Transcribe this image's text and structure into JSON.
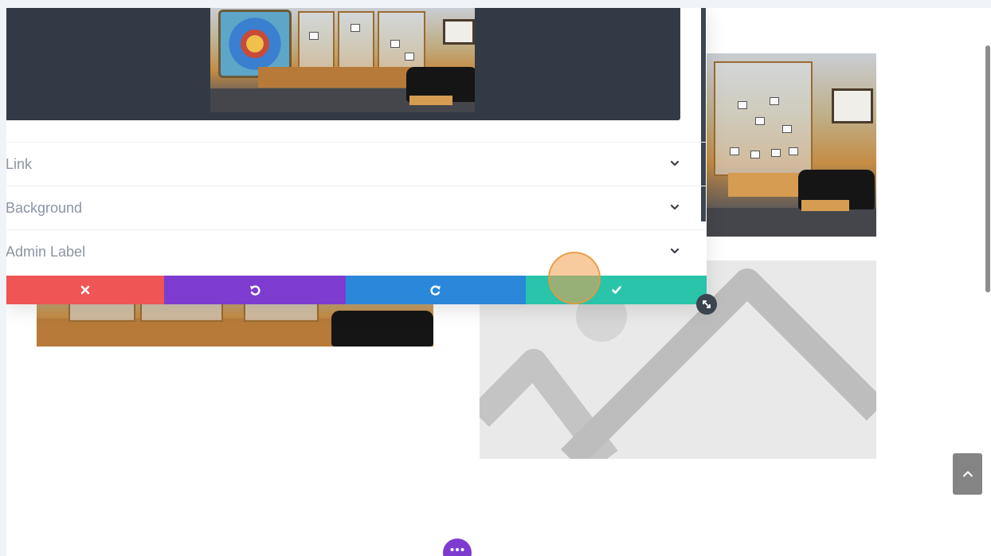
{
  "accordion": {
    "items": [
      {
        "label": "Link",
        "icon": "chevron-down-icon"
      },
      {
        "label": "Background",
        "icon": "chevron-down-icon"
      },
      {
        "label": "Admin Label",
        "icon": "chevron-down-icon"
      }
    ]
  },
  "action_bar": {
    "discard": {
      "icon": "close-icon",
      "color": "#ef5555"
    },
    "undo": {
      "icon": "undo-icon",
      "color": "#7e3bd0"
    },
    "redo": {
      "icon": "redo-icon",
      "color": "#2b87da"
    },
    "save": {
      "icon": "check-icon",
      "color": "#29c4a9"
    }
  },
  "colors": {
    "preview_background": "#323a45",
    "placeholder_background": "#e9e9e9",
    "accent_purple": "#7e3bd0",
    "label_gray": "#8b94a3"
  },
  "controls": {
    "resize_handle_icon": "resize-icon",
    "back_to_top_icon": "chevron-up-icon",
    "more_button_icon": "more-dots-icon"
  }
}
